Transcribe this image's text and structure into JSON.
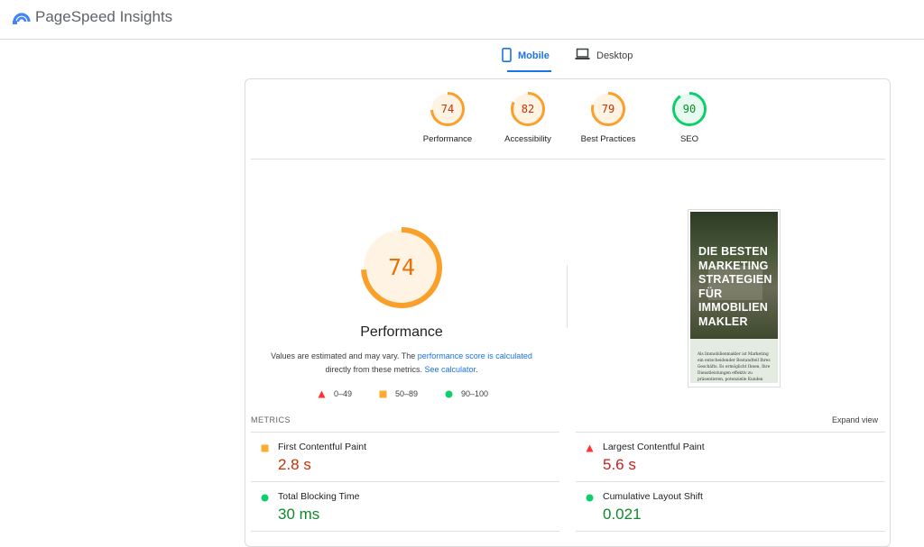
{
  "header": {
    "brand": "PageSpeed Insights"
  },
  "tabs": [
    {
      "label": "Mobile",
      "active": true,
      "icon": "phone-icon"
    },
    {
      "label": "Desktop",
      "active": false,
      "icon": "laptop-icon"
    }
  ],
  "scores": [
    {
      "value": "74",
      "label": "Performance",
      "score": 74,
      "color": "#fa9f29",
      "text_color": "#c33300"
    },
    {
      "value": "82",
      "label": "Accessibility",
      "score": 82,
      "color": "#fa9f29",
      "text_color": "#c33300"
    },
    {
      "value": "79",
      "label": "Best Practices",
      "score": 79,
      "color": "#fa9f29",
      "text_color": "#c33300"
    },
    {
      "value": "90",
      "label": "SEO",
      "score": 90,
      "color": "#0cce6b",
      "text_color": "#0d8a2a"
    }
  ],
  "performance": {
    "score": "74",
    "score_value": 74,
    "title": "Performance",
    "note_prefix": "Values are estimated and may vary. The ",
    "note_link1": "performance score is calculated",
    "note_mid": " directly from these metrics. ",
    "note_link2": "See calculator",
    "note_suffix": "."
  },
  "legend": [
    {
      "range": "0–49",
      "shape": "triangle",
      "color": "#ff3333"
    },
    {
      "range": "50–89",
      "shape": "square",
      "color": "#ffaa33"
    },
    {
      "range": "90–100",
      "shape": "circle",
      "color": "#0cce6b"
    }
  ],
  "screenshot": {
    "heading": "DIE BESTEN MARKETINGSTRATEGIEN FÜR IMMOBILIENMAKLER",
    "body": "Als Immobilienmakler ist Marketing ein entscheidender Bestandteil Ihres Geschäfts. Es ermöglicht Ihnen, Ihre Dienstleistungen effektiv zu präsentieren, potenzielle Kunden"
  },
  "metrics": {
    "header": "METRICS",
    "expand": "Expand view",
    "items": [
      {
        "name": "First Contentful Paint",
        "value": "2.8 s",
        "status": "average"
      },
      {
        "name": "Largest Contentful Paint",
        "value": "5.6 s",
        "status": "fail"
      },
      {
        "name": "Total Blocking Time",
        "value": "30 ms",
        "status": "pass"
      },
      {
        "name": "Cumulative Layout Shift",
        "value": "0.021",
        "status": "pass"
      }
    ]
  },
  "colors": {
    "accent": "#1a73e8",
    "average": "#ffaa33",
    "fail": "#ff3333",
    "pass": "#0cce6b"
  }
}
